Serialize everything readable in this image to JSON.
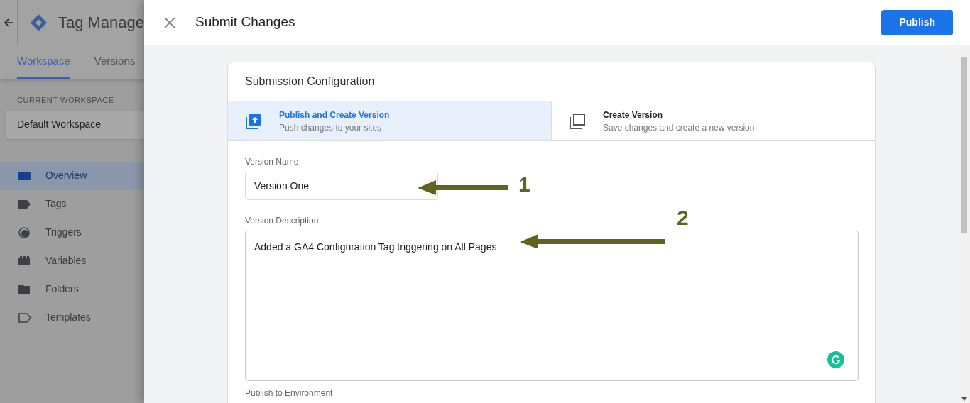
{
  "app": {
    "title": "Tag Manage",
    "tabs": [
      {
        "label": "Workspace",
        "selected": true
      },
      {
        "label": "Versions",
        "selected": false
      }
    ],
    "workspace_label": "CURRENT WORKSPACE",
    "workspace": "Default Workspace",
    "nav": [
      {
        "label": "Overview",
        "kind": "overview",
        "selected": true
      },
      {
        "label": "Tags",
        "kind": "tag",
        "selected": false
      },
      {
        "label": "Triggers",
        "kind": "trigger",
        "selected": false
      },
      {
        "label": "Variables",
        "kind": "variable",
        "selected": false
      },
      {
        "label": "Folders",
        "kind": "folder",
        "selected": false
      },
      {
        "label": "Templates",
        "kind": "template",
        "selected": false
      }
    ]
  },
  "dialog": {
    "title": "Submit Changes",
    "publish_button": "Publish",
    "card_title": "Submission Configuration",
    "options": [
      {
        "kind": "publish",
        "title": "Publish and Create Version",
        "subtitle": "Push changes to your sites",
        "selected": true
      },
      {
        "kind": "version",
        "title": "Create Version",
        "subtitle": "Save changes and create a new version",
        "selected": false
      }
    ],
    "version_name": {
      "label": "Version Name",
      "value": "Version One"
    },
    "version_description": {
      "label": "Version Description",
      "value": "Added a GA4 Configuration Tag triggering on All Pages"
    },
    "environment_label": "Publish to Environment"
  },
  "annotations": [
    {
      "label": "1"
    },
    {
      "label": "2"
    }
  ]
}
